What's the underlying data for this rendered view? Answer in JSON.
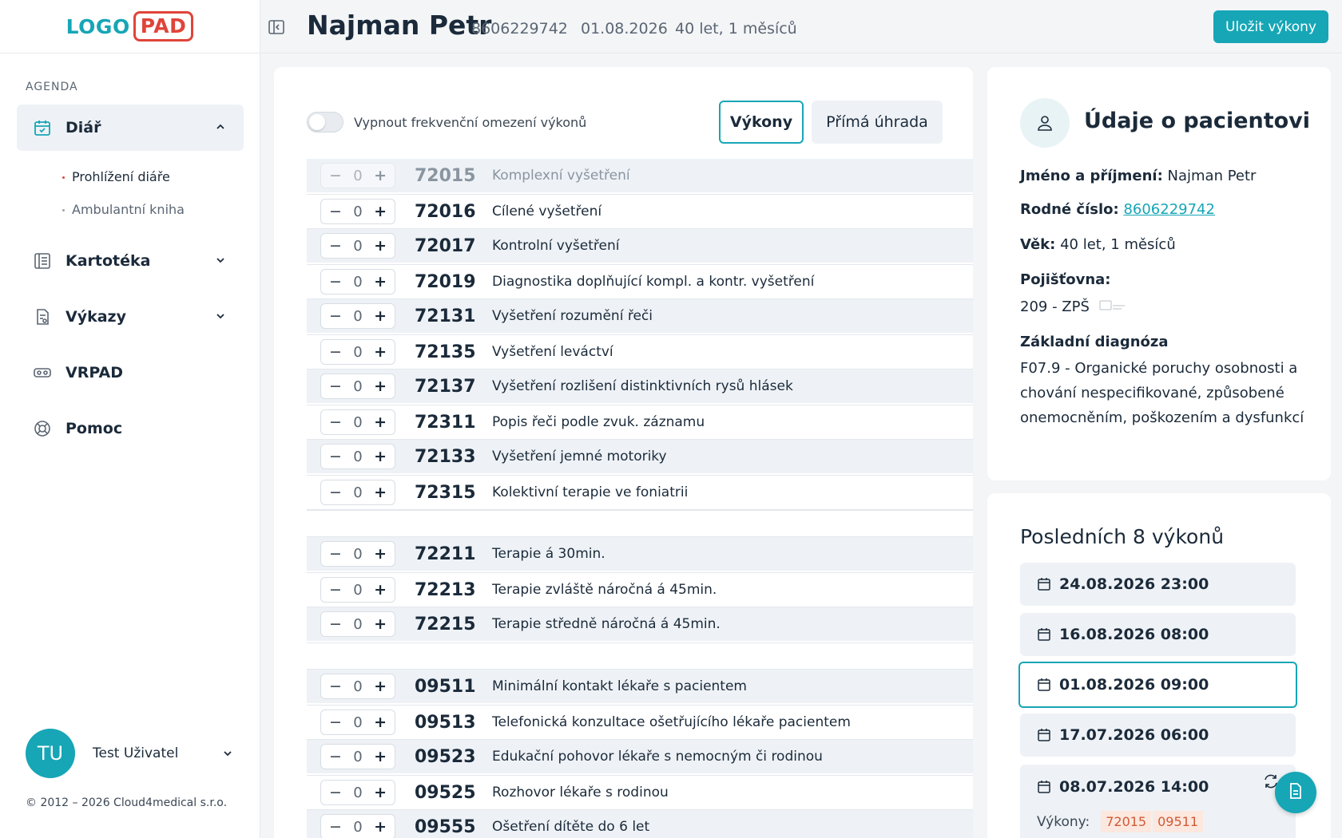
{
  "logo": {
    "part1": "LOGO",
    "part2": "PAD"
  },
  "sidebar": {
    "section": "AGENDA",
    "items": [
      {
        "label": "Diář",
        "icon": "calendar-check-icon"
      },
      {
        "label": "Kartotéka",
        "icon": "card-file-icon"
      },
      {
        "label": "Výkazy",
        "icon": "report-icon"
      },
      {
        "label": "VRPAD",
        "icon": "vr-headset-icon"
      },
      {
        "label": "Pomoc",
        "icon": "lifebuoy-icon"
      }
    ],
    "subitems": [
      {
        "label": "Prohlížení diáře"
      },
      {
        "label": "Ambulantní kniha"
      }
    ],
    "user": {
      "initials": "TU",
      "name": "Test Uživatel"
    },
    "copyright": "© 2012 – 2026 Cloud4medical s.r.o."
  },
  "header": {
    "patient_name": "Najman Petr",
    "birth_number": "8606229742",
    "date": "01.08.2026",
    "age": "40 let, 1 měsíců",
    "save_label": "Uložit výkony"
  },
  "main": {
    "toggle_label": "Vypnout frekvenční omezení výkonů",
    "tabs": [
      {
        "label": "Výkony"
      },
      {
        "label": "Přímá úhrada"
      }
    ],
    "rows": [
      {
        "count": "0",
        "code": "72015",
        "desc": "Komplexní vyšetření"
      },
      {
        "count": "0",
        "code": "72016",
        "desc": "Cílené vyšetření"
      },
      {
        "count": "0",
        "code": "72017",
        "desc": "Kontrolní vyšetření"
      },
      {
        "count": "0",
        "code": "72019",
        "desc": "Diagnostika doplňující kompl. a kontr. vyšetření"
      },
      {
        "count": "0",
        "code": "72131",
        "desc": "Vyšetření rozumění řeči"
      },
      {
        "count": "0",
        "code": "72135",
        "desc": "Vyšetření leváctví"
      },
      {
        "count": "0",
        "code": "72137",
        "desc": "Vyšetření rozlišení distinktivních rysů hlásek"
      },
      {
        "count": "0",
        "code": "72311",
        "desc": "Popis řeči podle zvuk. záznamu"
      },
      {
        "count": "0",
        "code": "72133",
        "desc": "Vyšetření jemné motoriky"
      },
      {
        "count": "0",
        "code": "72315",
        "desc": "Kolektivní terapie ve foniatrii"
      },
      {
        "count": "0",
        "code": "72211",
        "desc": "Terapie á 30min."
      },
      {
        "count": "0",
        "code": "72213",
        "desc": "Terapie zvláště náročná á 45min."
      },
      {
        "count": "0",
        "code": "72215",
        "desc": "Terapie středně náročná á 45min."
      },
      {
        "count": "0",
        "code": "09511",
        "desc": "Minimální kontakt lékaře s pacientem"
      },
      {
        "count": "0",
        "code": "09513",
        "desc": "Telefonická konzultace ošetřujícího lékaře pacientem"
      },
      {
        "count": "0",
        "code": "09523",
        "desc": "Edukační pohovor lékaře s nemocným či rodinou"
      },
      {
        "count": "0",
        "code": "09525",
        "desc": "Rozhovor lékaře s rodinou"
      },
      {
        "count": "0",
        "code": "09555",
        "desc": "Ošetření dítěte do 6 let"
      }
    ]
  },
  "patient_info": {
    "title": "Údaje o pacientovi",
    "name_label": "Jméno a příjmení:",
    "name_value": "Najman Petr",
    "birth_label": "Rodné číslo:",
    "birth_value": "8606229742",
    "age_label": "Věk:",
    "age_value": "40 let, 1 měsíců",
    "insurance_label": "Pojišťovna:",
    "insurance_value": "209 - ZPŠ",
    "diag_label": "Základní diagnóza",
    "diag_value": "F07.9 - Organické poruchy osobnosti a chování nespecifikované, způsobené onemocněním, poškozením a dysfunkcí"
  },
  "last_visits": {
    "title": "Posledních 8 výkonů",
    "visits": [
      {
        "date": "24.08.2026 23:00"
      },
      {
        "date": "16.08.2026 08:00"
      },
      {
        "date": "01.08.2026 09:00"
      },
      {
        "date": "17.07.2026 06:00"
      },
      {
        "date": "08.07.2026 14:00"
      }
    ],
    "detail_label": "Výkony:",
    "detail_codes": [
      "72015",
      "09511"
    ]
  },
  "colors": {
    "accent": "#16a6b6",
    "logo_red": "#e0443a",
    "chip_bg": "#fde8df"
  }
}
